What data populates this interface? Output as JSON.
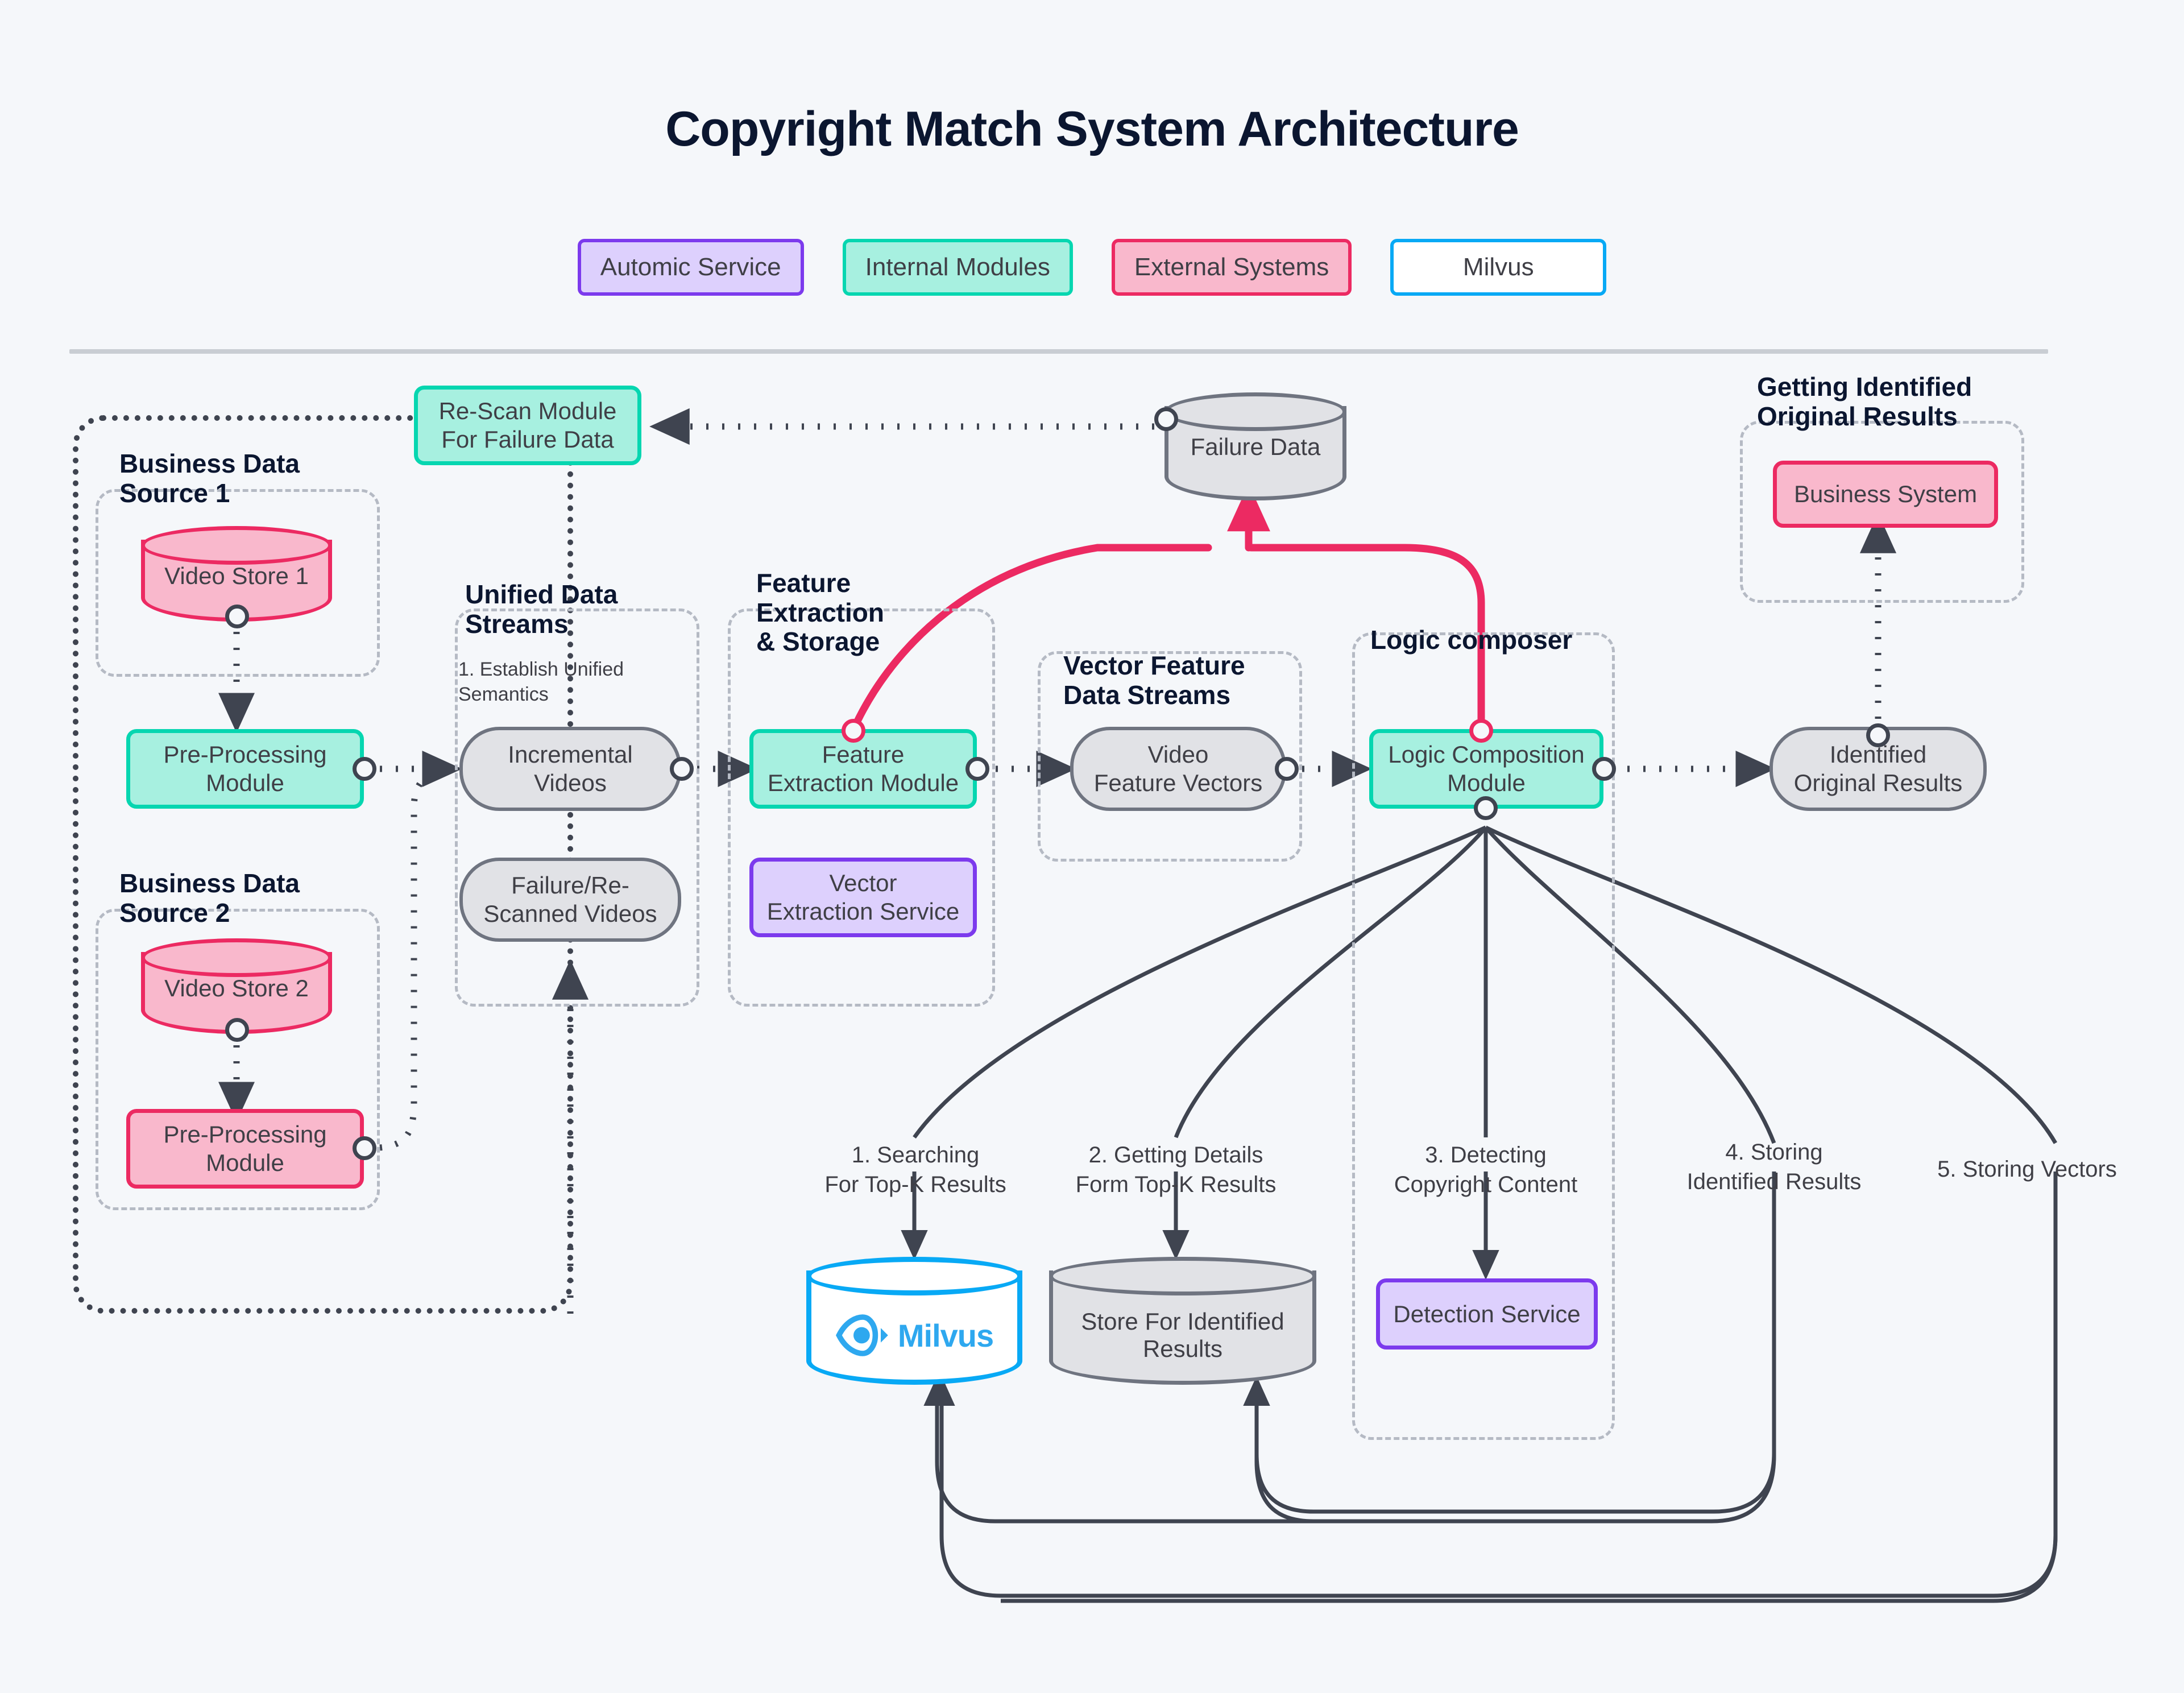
{
  "title": "Copyright Match System Architecture",
  "legend": [
    {
      "label": "Automic Service",
      "color": "#ddd0fd",
      "border": "#7c3aed"
    },
    {
      "label": "Internal Modules",
      "color": "#a7f0e0",
      "border": "#06d6b0"
    },
    {
      "label": "External Systems",
      "color": "#f9b8cc",
      "border": "#ec2a62"
    },
    {
      "label": "Milvus",
      "color": "#ffffff",
      "border": "#08a9f5"
    }
  ],
  "groups": {
    "business_source_1": "Business Data\nSource 1",
    "business_source_2": "Business Data\nSource 2",
    "unified_data_streams": "Unified Data\nStreams",
    "unified_note": "1. Establish Unified\nSemantics",
    "feature_extraction_storage": "Feature\nExtraction\n& Storage",
    "vector_feature_data_streams": "Vector Feature\nData Streams",
    "logic_composer": "Logic composer",
    "getting_identified_original_results": "Getting Identified\nOriginal Results"
  },
  "nodes": {
    "rescan_module": "Re-Scan Module\nFor Failure Data",
    "failure_data": "Failure Data",
    "video_store_1": "Video Store 1",
    "video_store_2": "Video Store 2",
    "preprocessing_1": "Pre-Processing\nModule",
    "preprocessing_2": "Pre-Processing\nModule",
    "incremental_videos": "Incremental\nVideos",
    "failure_rescanned_videos": "Failure/Re-\nScanned Videos",
    "feature_extraction_module": "Feature\nExtraction Module",
    "vector_extraction_service": "Vector\nExtraction Service",
    "video_feature_vectors": "Video\nFeature Vectors",
    "logic_composition_module": "Logic Composition\nModule",
    "identified_original_results": "Identified\nOriginal Results",
    "business_system": "Business System",
    "milvus": "Milvus",
    "store_for_identified_results": "Store For Identified\nResults",
    "detection_service": "Detection Service"
  },
  "flows": {
    "f1": "1. Searching\nFor Top-K Results",
    "f2": "2. Getting Details\nForm Top-K Results",
    "f3": "3. Detecting\nCopyright Content",
    "f4": "4. Storing\nIdentified Results",
    "f5": "5. Storing Vectors"
  },
  "colors": {
    "background": "#f5f7fa",
    "heading": "#0b1630",
    "text": "#3f3f46",
    "internal_fill": "#a7f0e0",
    "internal_stroke": "#06d6b0",
    "external_fill": "#f9b8cc",
    "external_stroke": "#ec2a62",
    "automic_fill": "#ddd0fd",
    "automic_stroke": "#7c3aed",
    "milvus_stroke": "#08a9f5",
    "milvus_logo": "#2ea8ef",
    "neutral_fill": "#e1e2e6",
    "neutral_stroke": "#6f7480",
    "edge_dark": "#3f4450",
    "edge_pink": "#ec2a62",
    "group_dash": "#b5bac4",
    "divider": "#c9cdd3"
  }
}
